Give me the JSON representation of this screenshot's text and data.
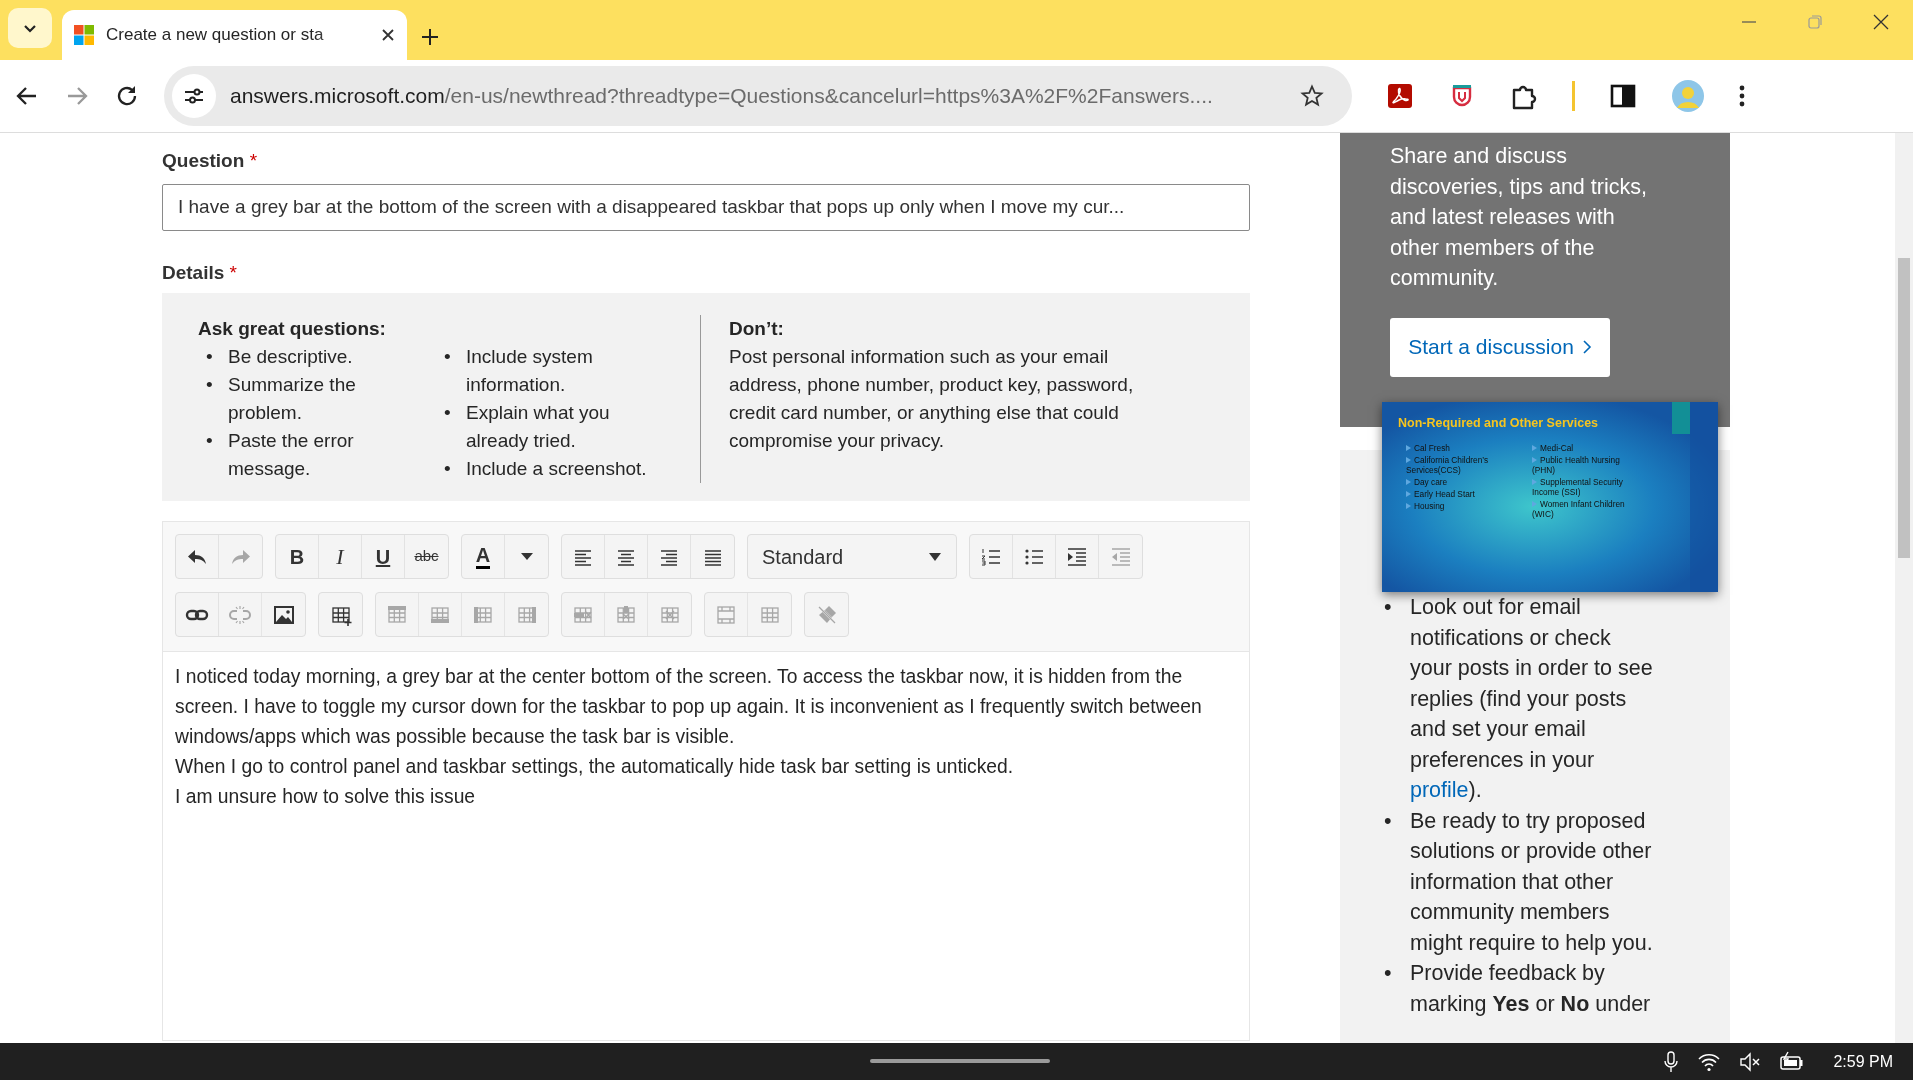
{
  "browser": {
    "tab_title": "Create a new question or sta",
    "url_host": "answers.microsoft.com",
    "url_path": "/en-us/newthread?threadtype=Questions&cancelurl=https%3A%2F%2Fanswers...."
  },
  "form": {
    "question_label": "Question",
    "question_required": "*",
    "question_value": "I have a grey bar at the bottom of the screen with a disappeared taskbar that pops up only when I move my cur...",
    "details_label": "Details",
    "details_required": "*",
    "tips": {
      "heading": "Ask great questions:",
      "marker": "•",
      "column_1": [
        "Be descriptive.",
        "Summarize the problem.",
        "Paste the error message."
      ],
      "column_2": [
        "Include system information.",
        "Explain what you already tried.",
        "Include a screenshot."
      ],
      "dont_heading": "Don’t:",
      "dont_text": "Post personal information such as your email address, phone number, product key, password, credit card number, or anything else that could compromise your privacy."
    },
    "toolbar": {
      "rows": [
        [
          [
            {
              "kind": "undo",
              "disabled": false
            },
            {
              "kind": "redo",
              "disabled": true
            }
          ],
          [
            {
              "kind": "bold",
              "label": "B",
              "disabled": false
            },
            {
              "kind": "italic",
              "label": "I",
              "disabled": false
            },
            {
              "kind": "underline",
              "label": "U",
              "disabled": false
            },
            {
              "kind": "strike",
              "label": "abc",
              "disabled": false
            }
          ],
          [
            {
              "kind": "color",
              "label": "A",
              "disabled": false
            },
            {
              "kind": "dropdown",
              "disabled": false
            }
          ],
          [
            {
              "kind": "align-left",
              "disabled": false
            },
            {
              "kind": "align-center",
              "disabled": false
            },
            {
              "kind": "align-right",
              "disabled": false
            },
            {
              "kind": "justify",
              "disabled": false
            }
          ],
          [
            {
              "kind": "select",
              "label": "Standard",
              "disabled": false
            }
          ],
          [
            {
              "kind": "ordered-list",
              "disabled": false
            },
            {
              "kind": "bullet-list",
              "disabled": false
            },
            {
              "kind": "indent",
              "disabled": false
            },
            {
              "kind": "outdent",
              "disabled": true
            }
          ]
        ],
        [
          [
            {
              "kind": "link",
              "disabled": false
            },
            {
              "kind": "unlink",
              "disabled": true
            },
            {
              "kind": "image",
              "disabled": false
            }
          ],
          [
            {
              "kind": "table-insert",
              "disabled": false
            }
          ],
          [
            {
              "kind": "row-above",
              "disabled": true
            },
            {
              "kind": "row-below",
              "disabled": true
            },
            {
              "kind": "col-left",
              "disabled": true
            },
            {
              "kind": "col-right",
              "disabled": true
            }
          ],
          [
            {
              "kind": "del-row",
              "disabled": true
            },
            {
              "kind": "del-col",
              "disabled": true
            },
            {
              "kind": "del-table",
              "disabled": true
            }
          ],
          [
            {
              "kind": "merge",
              "disabled": true
            },
            {
              "kind": "split",
              "disabled": true
            }
          ],
          [
            {
              "kind": "clear",
              "disabled": true
            }
          ]
        ]
      ]
    },
    "body": [
      "I noticed today morning, a grey bar at the center bottom of the screen. To access the taskbar now, it is hidden from the screen. I have to toggle my cursor down for the taskbar to pop up again. It is inconvenient as I frequently switch between windows/apps which was possible because the task bar is visible.",
      "When I go to control panel and taskbar settings, the automatically hide task bar setting is unticked.",
      "I am unsure how to solve this issue"
    ]
  },
  "sidebar": {
    "tips_marker": "•",
    "promo_text": "Share and discuss discoveries, tips and tricks, and latest releases with other members of the community.",
    "button": "Start a discussion",
    "slide": {
      "title": "Non-Required and Other Services",
      "left": [
        "Cal Fresh",
        "California Children’s Services(CCS)",
        "Day care",
        "Early Head Start",
        "Housing"
      ],
      "right": [
        "Medi-Cal",
        "Public Health Nursing (PHN)",
        "Supplemental Security Income (SSI)",
        "Women Infant Children (WIC)"
      ]
    },
    "tips": [
      {
        "text": "Look out for email notifications or check your posts in order to see replies (find your posts and set your email preferences in your ",
        "link": "profile",
        "after": ")."
      },
      {
        "text": "Be ready to try proposed solutions or provide other information that other community members might require to help you."
      },
      {
        "text": "Provide feedback by marking **Yes** or **No** under"
      }
    ]
  },
  "taskbar": {
    "time": "2:59 PM"
  }
}
